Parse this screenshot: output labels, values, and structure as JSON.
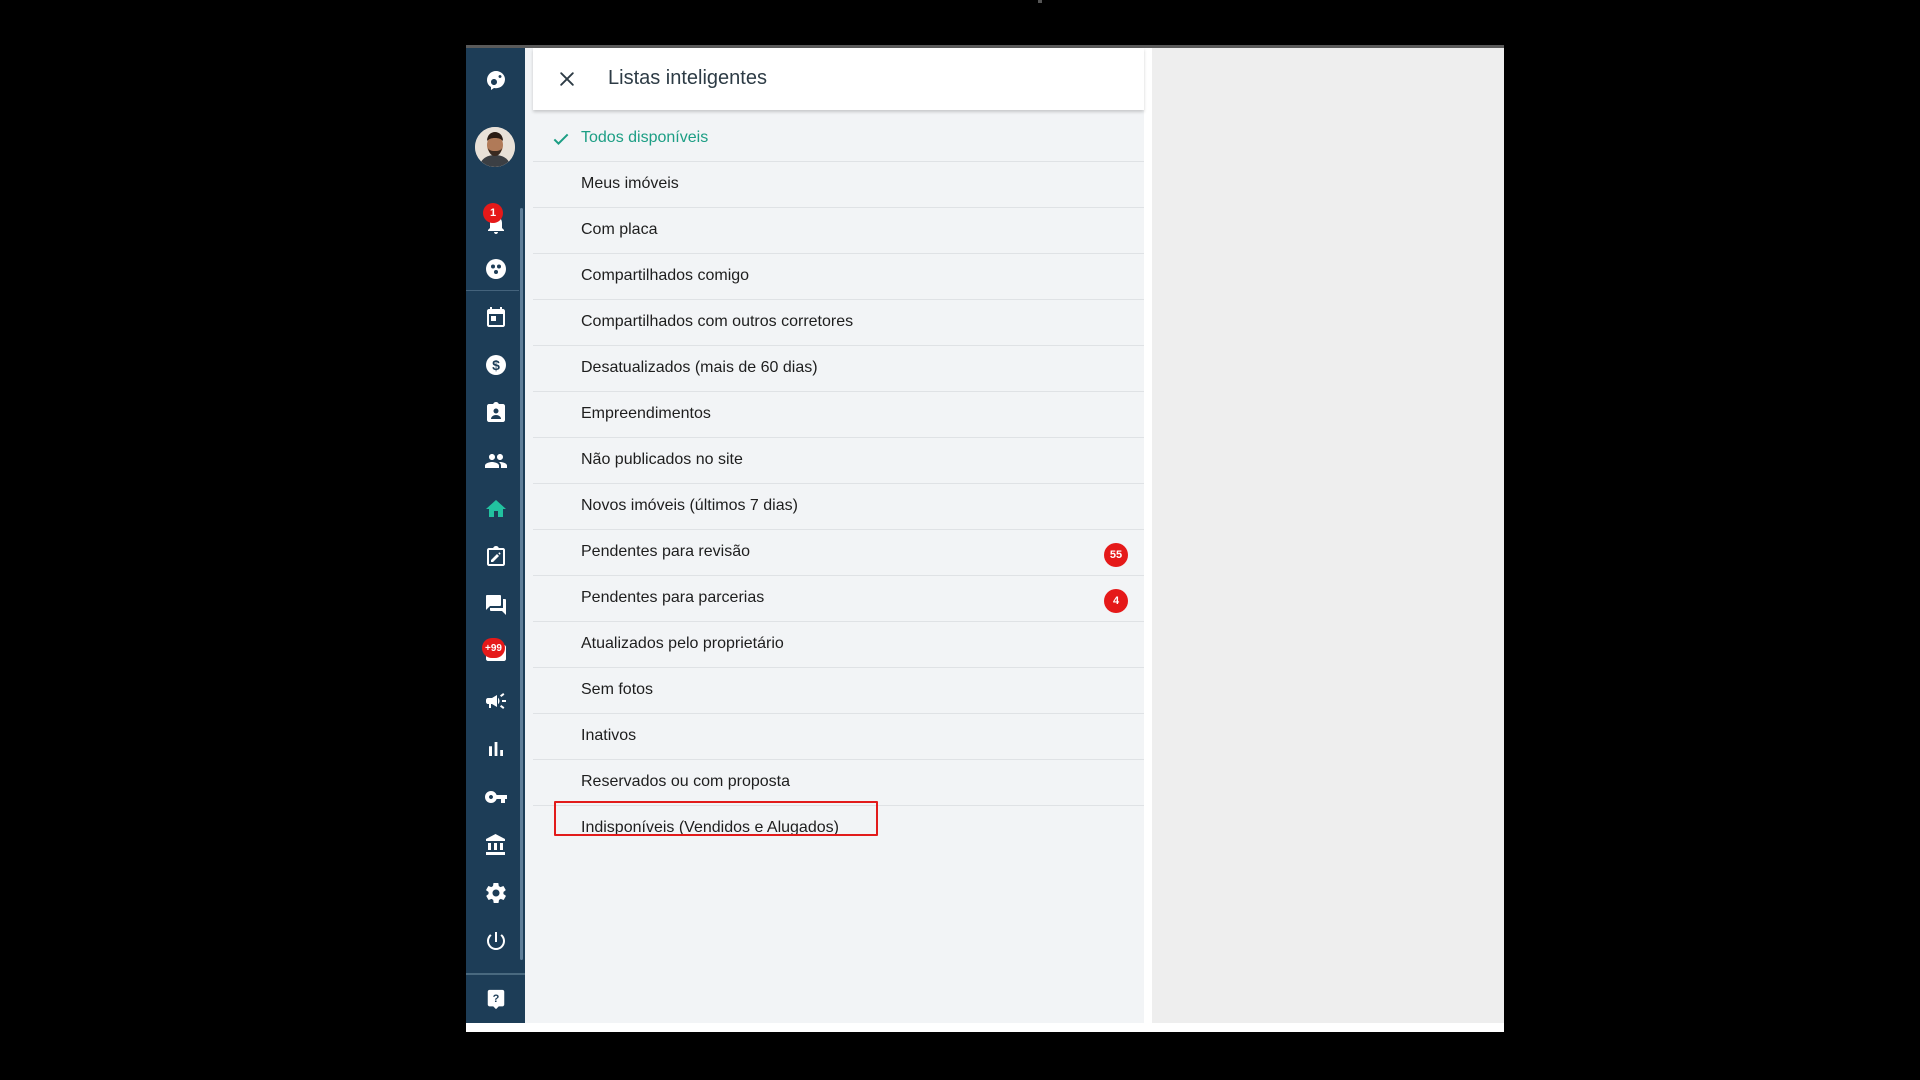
{
  "panel": {
    "title": "Listas inteligentes",
    "close_icon": "close-icon"
  },
  "sidebar": {
    "logo_icon": "chameleon-logo-icon",
    "notification_badge": "1",
    "mail_badge": "+99",
    "items": [
      {
        "icon": "bell-icon"
      },
      {
        "icon": "groups-icon"
      },
      {
        "icon": "calendar-icon"
      },
      {
        "icon": "dollar-icon"
      },
      {
        "icon": "contact-card-icon"
      },
      {
        "icon": "people-icon"
      },
      {
        "icon": "home-icon",
        "active": true
      },
      {
        "icon": "edit-square-icon"
      },
      {
        "icon": "chat-icon"
      },
      {
        "icon": "mail-icon"
      },
      {
        "icon": "megaphone-icon"
      },
      {
        "icon": "bar-chart-icon"
      },
      {
        "icon": "key-icon"
      },
      {
        "icon": "bank-icon"
      },
      {
        "icon": "gear-icon"
      },
      {
        "icon": "power-icon"
      },
      {
        "icon": "help-icon"
      }
    ]
  },
  "lists": [
    {
      "label": "Todos disponíveis",
      "active": true
    },
    {
      "label": "Meus imóveis"
    },
    {
      "label": "Com placa"
    },
    {
      "label": "Compartilhados comigo"
    },
    {
      "label": "Compartilhados com outros corretores"
    },
    {
      "label": "Desatualizados (mais de 60 dias)"
    },
    {
      "label": "Empreendimentos"
    },
    {
      "label": "Não publicados no site"
    },
    {
      "label": "Novos imóveis (últimos 7 dias)"
    },
    {
      "label": "Pendentes para revisão",
      "badge": "55"
    },
    {
      "label": "Pendentes para parcerias",
      "badge": "4"
    },
    {
      "label": "Atualizados pelo proprietário"
    },
    {
      "label": "Sem fotos"
    },
    {
      "label": "Inativos"
    },
    {
      "label": "Reservados ou com proposta"
    },
    {
      "label": "Indisponíveis (Vendidos e Alugados)",
      "highlighted": true
    }
  ],
  "colors": {
    "sidebar_bg": "#1d3d57",
    "accent": "#1c9e84",
    "badge": "#e51919",
    "highlight_border": "#e21b1b"
  }
}
